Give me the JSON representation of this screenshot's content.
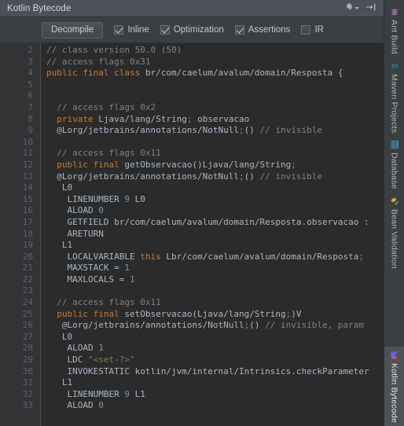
{
  "window": {
    "title": "Kotlin Bytecode",
    "actions": [
      {
        "name": "settings-gear",
        "icon": "gear-icon",
        "label": ""
      },
      {
        "name": "hide-panel",
        "icon": "hide-icon",
        "label": ""
      }
    ]
  },
  "toolbar": {
    "decompile_label": "Decompile",
    "checkboxes": [
      {
        "label": "Inline",
        "checked": true
      },
      {
        "label": "Optimization",
        "checked": true
      },
      {
        "label": "Assertions",
        "checked": true
      },
      {
        "label": "IR",
        "checked": false
      }
    ]
  },
  "editor": {
    "first_line_number": 2,
    "lines": [
      {
        "n": 2,
        "tokens": [
          {
            "t": "// class version 50.0 (50)",
            "c": "cm"
          }
        ]
      },
      {
        "n": 3,
        "tokens": [
          {
            "t": "// access flags 0x31",
            "c": "cm"
          }
        ]
      },
      {
        "n": 4,
        "tokens": [
          {
            "t": "public final class ",
            "c": "k"
          },
          {
            "t": "br/com/caelum/avalum/domain/Resposta {",
            "c": "pl"
          }
        ]
      },
      {
        "n": 5,
        "tokens": [
          {
            "t": "",
            "c": "pl"
          }
        ]
      },
      {
        "n": 6,
        "tokens": [
          {
            "t": "",
            "c": "pl"
          }
        ]
      },
      {
        "n": 7,
        "tokens": [
          {
            "t": "  // access flags 0x2",
            "c": "cm"
          }
        ]
      },
      {
        "n": 8,
        "tokens": [
          {
            "t": "  ",
            "c": "pl"
          },
          {
            "t": "private ",
            "c": "k"
          },
          {
            "t": "Ljava/lang/String",
            "c": "pl"
          },
          {
            "t": ";",
            "c": "k"
          },
          {
            "t": " observacao",
            "c": "pl"
          }
        ]
      },
      {
        "n": 9,
        "tokens": [
          {
            "t": "  @Lorg/jetbrains/annotations/NotNull",
            "c": "pl"
          },
          {
            "t": ";",
            "c": "k"
          },
          {
            "t": "() ",
            "c": "pl"
          },
          {
            "t": "// invisible",
            "c": "cm"
          }
        ]
      },
      {
        "n": 10,
        "tokens": [
          {
            "t": "",
            "c": "pl"
          }
        ]
      },
      {
        "n": 11,
        "tokens": [
          {
            "t": "  // access flags 0x11",
            "c": "cm"
          }
        ]
      },
      {
        "n": 12,
        "tokens": [
          {
            "t": "  ",
            "c": "pl"
          },
          {
            "t": "public final ",
            "c": "k"
          },
          {
            "t": "getObservacao()Ljava/lang/String",
            "c": "pl"
          },
          {
            "t": ";",
            "c": "k"
          }
        ]
      },
      {
        "n": 13,
        "tokens": [
          {
            "t": "  @Lorg/jetbrains/annotations/NotNull",
            "c": "pl"
          },
          {
            "t": ";",
            "c": "k"
          },
          {
            "t": "() ",
            "c": "pl"
          },
          {
            "t": "// invisible",
            "c": "cm"
          }
        ]
      },
      {
        "n": 14,
        "tokens": [
          {
            "t": "   L0",
            "c": "pl"
          }
        ]
      },
      {
        "n": 15,
        "tokens": [
          {
            "t": "    LINENUMBER ",
            "c": "pl"
          },
          {
            "t": "9",
            "c": "nm"
          },
          {
            "t": " L0",
            "c": "pl"
          }
        ]
      },
      {
        "n": 16,
        "tokens": [
          {
            "t": "    ALOAD ",
            "c": "pl"
          },
          {
            "t": "0",
            "c": "nm"
          }
        ]
      },
      {
        "n": 17,
        "tokens": [
          {
            "t": "    GETFIELD br/com/caelum/avalum/domain/Resposta.observacao :",
            "c": "pl"
          }
        ]
      },
      {
        "n": 18,
        "tokens": [
          {
            "t": "    ARETURN",
            "c": "pl"
          }
        ]
      },
      {
        "n": 19,
        "tokens": [
          {
            "t": "   L1",
            "c": "pl"
          }
        ]
      },
      {
        "n": 20,
        "tokens": [
          {
            "t": "    LOCALVARIABLE ",
            "c": "pl"
          },
          {
            "t": "this",
            "c": "k"
          },
          {
            "t": " Lbr/com/caelum/avalum/domain/Resposta",
            "c": "pl"
          },
          {
            "t": ";",
            "c": "k"
          }
        ]
      },
      {
        "n": 21,
        "tokens": [
          {
            "t": "    MAXSTACK = ",
            "c": "pl"
          },
          {
            "t": "1",
            "c": "nm"
          }
        ]
      },
      {
        "n": 22,
        "tokens": [
          {
            "t": "    MAXLOCALS = ",
            "c": "pl"
          },
          {
            "t": "1",
            "c": "nm"
          }
        ]
      },
      {
        "n": 23,
        "tokens": [
          {
            "t": "",
            "c": "pl"
          }
        ]
      },
      {
        "n": 24,
        "tokens": [
          {
            "t": "  // access flags 0x11",
            "c": "cm"
          }
        ]
      },
      {
        "n": 25,
        "tokens": [
          {
            "t": "  ",
            "c": "pl"
          },
          {
            "t": "public final ",
            "c": "k"
          },
          {
            "t": "setObservacao(Ljava/lang/String",
            "c": "pl"
          },
          {
            "t": ";",
            "c": "k"
          },
          {
            "t": ")V",
            "c": "pl"
          }
        ]
      },
      {
        "n": 26,
        "tokens": [
          {
            "t": "   @Lorg/jetbrains/annotations/NotNull",
            "c": "pl"
          },
          {
            "t": ";",
            "c": "k"
          },
          {
            "t": "() ",
            "c": "pl"
          },
          {
            "t": "// invisible, param",
            "c": "cm"
          }
        ]
      },
      {
        "n": 27,
        "tokens": [
          {
            "t": "   L0",
            "c": "pl"
          }
        ]
      },
      {
        "n": 28,
        "tokens": [
          {
            "t": "    ALOAD ",
            "c": "pl"
          },
          {
            "t": "1",
            "c": "nm"
          }
        ]
      },
      {
        "n": 29,
        "tokens": [
          {
            "t": "    LDC ",
            "c": "pl"
          },
          {
            "t": "\"<set-?>\"",
            "c": "st"
          }
        ]
      },
      {
        "n": 30,
        "tokens": [
          {
            "t": "    INVOKESTATIC kotlin/jvm/internal/Intrinsics.checkParameter",
            "c": "pl"
          }
        ]
      },
      {
        "n": 31,
        "tokens": [
          {
            "t": "   L1",
            "c": "pl"
          }
        ]
      },
      {
        "n": 32,
        "tokens": [
          {
            "t": "    LINENUMBER ",
            "c": "pl"
          },
          {
            "t": "9",
            "c": "nm"
          },
          {
            "t": " L1",
            "c": "pl"
          }
        ]
      },
      {
        "n": 33,
        "tokens": [
          {
            "t": "    ALOAD ",
            "c": "pl"
          },
          {
            "t": "0",
            "c": "nm"
          }
        ]
      }
    ]
  },
  "toolstrip": {
    "tabs": [
      {
        "label": "Ant Build",
        "icon": "ant-icon",
        "active": false
      },
      {
        "label": "Maven Projects",
        "icon": "maven-m-icon",
        "active": false
      },
      {
        "label": "Database",
        "icon": "database-icon",
        "active": false
      },
      {
        "label": "Bean Validation",
        "icon": "bean-icon",
        "active": false
      },
      {
        "label": "Kotlin Bytecode",
        "icon": "kotlin-icon",
        "active": true
      }
    ]
  },
  "colors": {
    "titlebar_bg": "#4B5059",
    "panel_bg": "#3C3F41",
    "editor_bg": "#2B2B2B",
    "gutter_bg": "#313335",
    "keyword": "#CC7832",
    "comment": "#808080",
    "string": "#6A8759",
    "number": "#6897BB",
    "text": "#A9B7C6"
  }
}
